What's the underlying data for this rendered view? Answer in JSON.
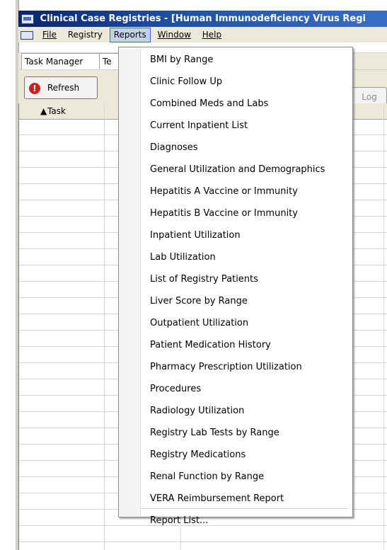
{
  "window": {
    "title": "Clinical Case Registries - [Human Immunodeficiency Virus Regi"
  },
  "menubar": {
    "items": [
      "File",
      "Registry",
      "Reports",
      "Window",
      "Help"
    ]
  },
  "tabs": {
    "active": "Task Manager",
    "second_truncated": "Te"
  },
  "toolbar": {
    "refresh_label": "Refresh",
    "log_label": "Log"
  },
  "grid": {
    "header_task": "Task"
  },
  "reports_menu": {
    "items": [
      "BMI by Range",
      "Clinic Follow Up",
      "Combined Meds and Labs",
      "Current Inpatient List",
      "Diagnoses",
      "General Utilization and Demographics",
      "Hepatitis A Vaccine or Immunity",
      "Hepatitis B Vaccine or Immunity",
      "Inpatient Utilization",
      "Lab Utilization",
      "List of Registry Patients",
      "Liver Score by Range",
      "Outpatient Utilization",
      "Patient Medication History",
      "Pharmacy Prescription Utilization",
      "Procedures",
      "Radiology Utilization",
      "Registry Lab Tests by Range",
      "Registry Medications",
      "Renal Function by Range",
      "VERA Reimbursement Report"
    ],
    "footer_item": "Report List..."
  },
  "colors": {
    "title_gradient_start": "#0a246a",
    "title_gradient_end": "#3a6ec6",
    "menu_active_bg": "#c1d2ee",
    "menu_active_border": "#316ac5",
    "refresh_icon": "#d11f1f"
  },
  "icons": [
    "app-icon",
    "refresh-icon",
    "sort-arrow-icon"
  ]
}
